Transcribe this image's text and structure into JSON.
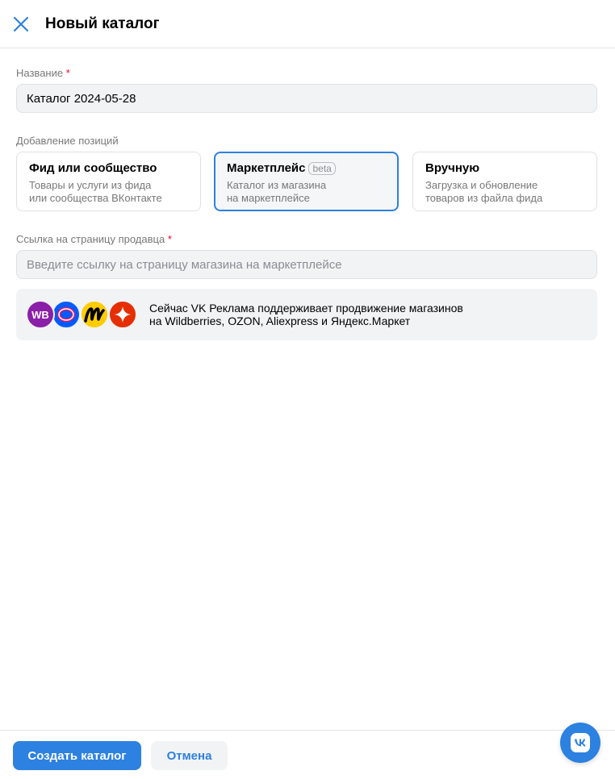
{
  "header": {
    "title": "Новый каталог",
    "close_icon": "close-icon"
  },
  "form": {
    "name": {
      "label": "Название",
      "required_mark": "*",
      "value": "Каталог 2024-05-28"
    },
    "add_items": {
      "label": "Добавление позиций",
      "options": [
        {
          "title": "Фид или сообщество",
          "desc_line1": "Товары и услуги из фида",
          "desc_line2": "или сообщества ВКонтакте",
          "selected": false
        },
        {
          "title": "Маркетплейс",
          "badge": "beta",
          "desc_line1": "Каталог из магазина",
          "desc_line2": "на маркетплейсе",
          "selected": true
        },
        {
          "title": "Вручную",
          "desc_line1": "Загрузка и обновление",
          "desc_line2": "товаров из файла фида",
          "selected": false
        }
      ]
    },
    "seller_link": {
      "label": "Ссылка на страницу продавца",
      "required_mark": "*",
      "placeholder": "Введите ссылку на страницу магазина на маркетплейсе"
    }
  },
  "info": {
    "line1": "Сейчас VK Реклама поддерживает продвижение магазинов",
    "line2": "на Wildberries, OZON, Aliexpress и Яндекс.Маркет",
    "logos": [
      {
        "name": "wildberries-logo",
        "text": "WB",
        "color": "#8b1fa8"
      },
      {
        "name": "ozon-logo",
        "color": "#005bff"
      },
      {
        "name": "yandex-market-logo",
        "color": "#ffcc00"
      },
      {
        "name": "aliexpress-logo",
        "color": "#e62e04"
      }
    ]
  },
  "footer": {
    "create_label": "Создать каталог",
    "cancel_label": "Отмена"
  },
  "colors": {
    "accent": "#2d81e0",
    "required": "#ed0a34"
  },
  "fab_icon": "vk-logo-icon"
}
